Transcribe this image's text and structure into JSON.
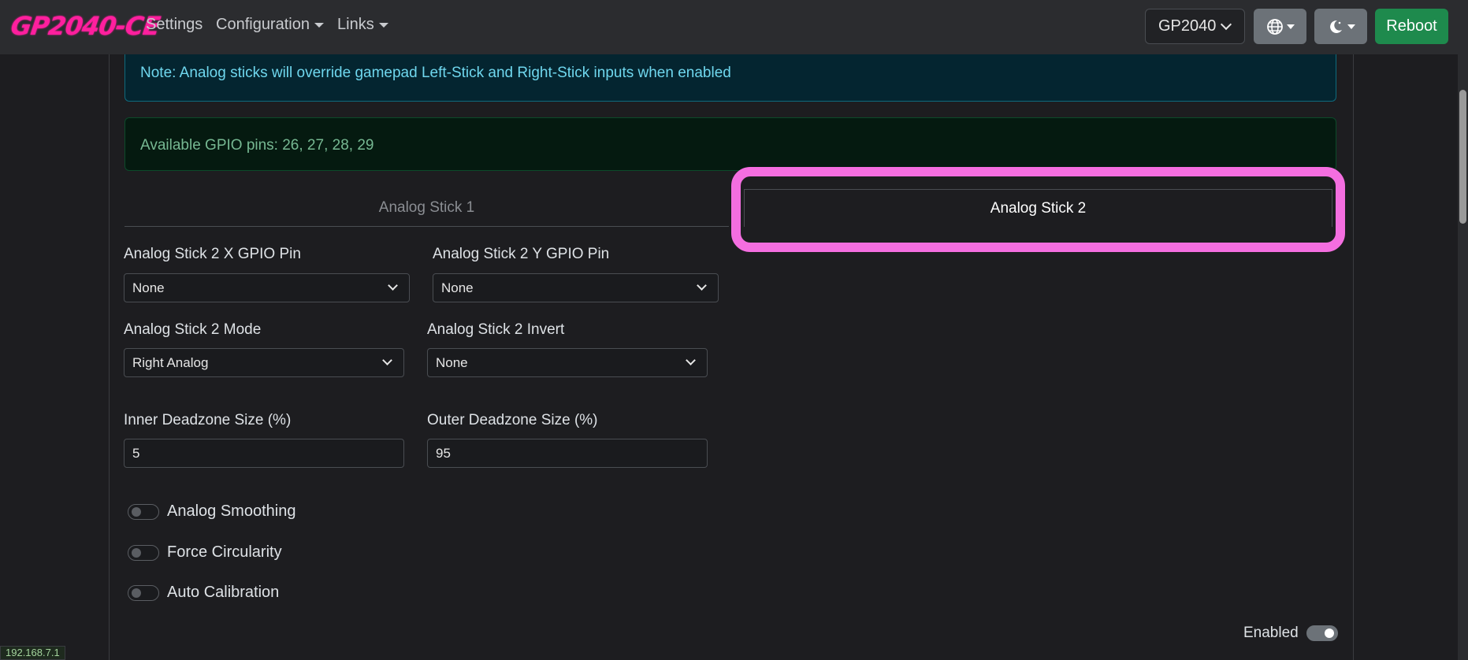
{
  "navbar": {
    "brand": "GP2040-CE",
    "links": [
      {
        "label": "Settings"
      },
      {
        "label": "Configuration"
      },
      {
        "label": "Links"
      }
    ],
    "board_select": "GP2040",
    "reboot_label": "Reboot"
  },
  "alerts": {
    "info": "Note: Analog sticks will override gamepad Left-Stick and Right-Stick inputs when enabled",
    "pins": "Available GPIO pins: 26, 27, 28, 29"
  },
  "tabs": [
    {
      "label": "Analog Stick 1",
      "active": false
    },
    {
      "label": "Analog Stick 2",
      "active": true
    }
  ],
  "form": {
    "x_pin_label": "Analog Stick 2 X GPIO Pin",
    "x_pin_value": "None",
    "y_pin_label": "Analog Stick 2 Y GPIO Pin",
    "y_pin_value": "None",
    "mode_label": "Analog Stick 2 Mode",
    "mode_value": "Right Analog",
    "invert_label": "Analog Stick 2 Invert",
    "invert_value": "None",
    "inner_deadzone_label": "Inner Deadzone Size (%)",
    "inner_deadzone_value": "5",
    "outer_deadzone_label": "Outer Deadzone Size (%)",
    "outer_deadzone_value": "95"
  },
  "toggles": [
    {
      "label": "Analog Smoothing",
      "on": false
    },
    {
      "label": "Force Circularity",
      "on": false
    },
    {
      "label": "Auto Calibration",
      "on": false
    }
  ],
  "enabled": {
    "label": "Enabled",
    "on": true
  },
  "status_bar": {
    "ip": "192.168.7.1"
  },
  "colors": {
    "brand": "#ff1f9e",
    "highlight": "#f46ee0",
    "reboot": "#1e8a4d"
  }
}
